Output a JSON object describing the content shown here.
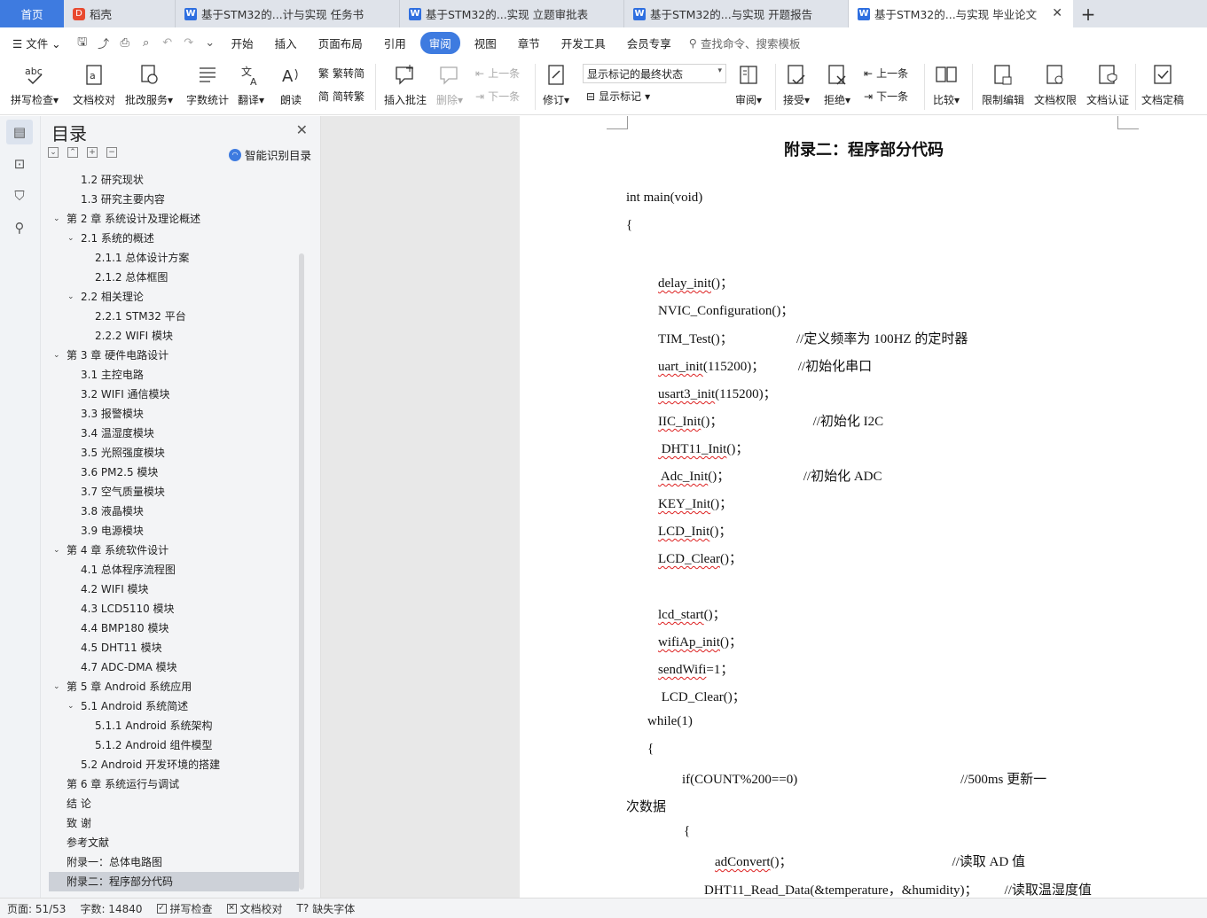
{
  "tabs": {
    "home": "首页",
    "daoke": "稻壳",
    "docs": [
      "基于STM32的...计与实现 任务书",
      "基于STM32的...实现 立题审批表",
      "基于STM32的...与实现 开题报告",
      "基于STM32的...与实现 毕业论文"
    ],
    "active_index": 3
  },
  "menu": {
    "file": "文件",
    "items": [
      "开始",
      "插入",
      "页面布局",
      "引用",
      "审阅",
      "视图",
      "章节",
      "开发工具",
      "会员专享"
    ],
    "active": "审阅",
    "search_placeholder": "查找命令、搜索模板"
  },
  "ribbon": {
    "spell": "拼写检查",
    "proof": "文档校对",
    "annot_service": "批改服务",
    "wordcount": "字数统计",
    "translate": "翻译",
    "read": "朗读",
    "trad": "繁转简",
    "simp": "简转繁",
    "insert_comment": "插入批注",
    "delete": "删除",
    "prev_comment": "上一条",
    "next_comment": "下一条",
    "revise": "修订",
    "markup_state": "显示标记的最终状态",
    "show_markup": "显示标记",
    "review": "审阅",
    "accept": "接受",
    "reject": "拒绝",
    "prev_change": "上一条",
    "next_change": "下一条",
    "compare": "比较",
    "restrict": "限制编辑",
    "permission": "文档权限",
    "certify": "文档认证",
    "finalize": "文档定稿"
  },
  "toc": {
    "title": "目录",
    "smart": "智能识别目录",
    "items": [
      {
        "text": "1.2  研究现状",
        "level": 2
      },
      {
        "text": "1.3  研究主要内容",
        "level": 2
      },
      {
        "text": "第 2 章  系统设计及理论概述",
        "level": 1,
        "caret": true
      },
      {
        "text": "2.1  系统的概述",
        "level": 2,
        "caret": true
      },
      {
        "text": "2.1.1  总体设计方案",
        "level": 3
      },
      {
        "text": "2.1.2  总体框图",
        "level": 3
      },
      {
        "text": "2.2  相关理论",
        "level": 2,
        "caret": true
      },
      {
        "text": "2.2.1 STM32 平台",
        "level": 3
      },
      {
        "text": "2.2.2 WIFI 模块",
        "level": 3
      },
      {
        "text": "第 3 章  硬件电路设计",
        "level": 1,
        "caret": true
      },
      {
        "text": "3.1  主控电路",
        "level": 2
      },
      {
        "text": "3.2 WIFI 通信模块",
        "level": 2
      },
      {
        "text": "3.3  报警模块",
        "level": 2
      },
      {
        "text": "3.4  温湿度模块",
        "level": 2
      },
      {
        "text": "3.5  光照强度模块",
        "level": 2
      },
      {
        "text": "3.6 PM2.5 模块",
        "level": 2
      },
      {
        "text": "3.7  空气质量模块",
        "level": 2
      },
      {
        "text": "3.8  液晶模块",
        "level": 2
      },
      {
        "text": "3.9  电源模块",
        "level": 2
      },
      {
        "text": "第 4 章  系统软件设计",
        "level": 1,
        "caret": true
      },
      {
        "text": "4.1  总体程序流程图",
        "level": 2
      },
      {
        "text": "4.2 WIFI 模块",
        "level": 2
      },
      {
        "text": "4.3 LCD5110 模块",
        "level": 2
      },
      {
        "text": "4.4 BMP180 模块",
        "level": 2
      },
      {
        "text": "4.5 DHT11 模块",
        "level": 2
      },
      {
        "text": "4.7 ADC-DMA 模块",
        "level": 2
      },
      {
        "text": "第 5 章  Android 系统应用",
        "level": 1,
        "caret": true
      },
      {
        "text": "5.1 Android 系统简述",
        "level": 2,
        "caret": true
      },
      {
        "text": "5.1.1 Android 系统架构",
        "level": 3
      },
      {
        "text": "5.1.2 Android 组件模型",
        "level": 3
      },
      {
        "text": "5.2 Android 开发环境的搭建",
        "level": 2
      },
      {
        "text": "第 6 章  系统运行与调试",
        "level": 1
      },
      {
        "text": "结    论",
        "level": 1
      },
      {
        "text": "致    谢",
        "level": 1
      },
      {
        "text": "参考文献",
        "level": 1
      },
      {
        "text": "附录一：总体电路图",
        "level": 1
      },
      {
        "text": "附录二：程序部分代码",
        "level": 1,
        "selected": true
      }
    ]
  },
  "document": {
    "heading": "附录二：程序部分代码",
    "lines": [
      {
        "segs": [
          {
            "t": "int main(void)"
          }
        ]
      },
      {
        "segs": [
          {
            "t": "{"
          }
        ]
      },
      {
        "segs": []
      },
      {
        "segs": [
          {
            "t": "delay_init",
            "sq": true
          },
          {
            "t": "()；"
          }
        ]
      },
      {
        "segs": [
          {
            "t": "NVIC_Configuration()；"
          }
        ]
      },
      {
        "segs": [
          {
            "t": "TIM_Test()；                   //定义频率为 100HZ 的定时器"
          }
        ]
      },
      {
        "segs": [
          {
            "t": "uart_init",
            "sq": true
          },
          {
            "t": "(115200)；          //初始化串口"
          }
        ]
      },
      {
        "segs": [
          {
            "t": "usart3_init",
            "sq": true
          },
          {
            "t": "(115200)；"
          }
        ]
      },
      {
        "segs": [
          {
            "t": "IIC_Init",
            "sq": true
          },
          {
            "t": "()；                           //初始化 I2C"
          }
        ]
      },
      {
        "segs": [
          {
            "t": " DHT11_Init",
            "sq": true
          },
          {
            "t": "()；"
          }
        ]
      },
      {
        "segs": [
          {
            "t": " Adc_Init",
            "sq": true
          },
          {
            "t": "()；                      //初始化 ADC"
          }
        ]
      },
      {
        "segs": [
          {
            "t": "KEY_Init",
            "sq": true
          },
          {
            "t": "()；"
          }
        ]
      },
      {
        "segs": [
          {
            "t": "LCD_Init",
            "sq": true
          },
          {
            "t": "()；"
          }
        ]
      },
      {
        "segs": [
          {
            "t": "LCD_Clear",
            "sq": true
          },
          {
            "t": "()；"
          }
        ]
      },
      {
        "segs": []
      },
      {
        "segs": [
          {
            "t": "lcd_start",
            "sq": true
          },
          {
            "t": "()；"
          }
        ]
      },
      {
        "segs": [
          {
            "t": "wifiAp_init",
            "sq": true
          },
          {
            "t": "()；"
          }
        ]
      },
      {
        "segs": [
          {
            "t": "sendWifi",
            "sq": true
          },
          {
            "t": "=1；"
          }
        ]
      },
      {
        "segs": [
          {
            "t": " LCD_Clear()；"
          }
        ]
      },
      {
        "segs": [
          {
            "t": "while(1)"
          }
        ]
      },
      {
        "segs": [
          {
            "t": "{"
          }
        ]
      },
      {
        "segs": [
          {
            "t": "if(COUNT%200==0)                                                 //500ms 更新一"
          }
        ]
      },
      {
        "segs": [
          {
            "t": "次数据"
          }
        ]
      },
      {
        "segs": [
          {
            "t": "{"
          }
        ]
      },
      {
        "segs": [
          {
            "t": "adConvert",
            "sq": true
          },
          {
            "t": "()；                                                //读取 AD 值"
          }
        ]
      },
      {
        "segs": [
          {
            "t": "DHT11_Read_Data(&temperature，&humidity)；        //读取温湿度值"
          }
        ]
      }
    ]
  },
  "status": {
    "page": "页面: 51/53",
    "words": "字数: 14840",
    "spell": "拼写检查",
    "proof": "文档校对",
    "missing_font": "缺失字体"
  }
}
